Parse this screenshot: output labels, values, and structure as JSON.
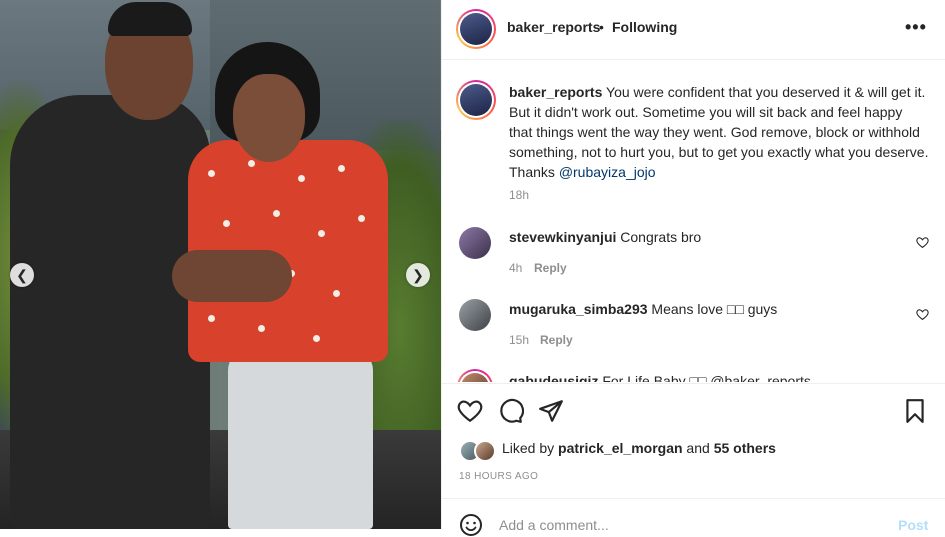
{
  "header": {
    "username": "baker_reports",
    "separator": "•",
    "follow_state": "Following",
    "more_label": "•••"
  },
  "caption": {
    "username": "baker_reports",
    "text": "You were confident that you deserved it & will get it. But it didn't work out. Sometime you will sit back and feel happy that things went the way they went. God remove, block or withhold something, not to hurt you, but to get you exactly what you deserve. Thanks ",
    "mention": "@rubayiza_jojo",
    "time": "18h"
  },
  "comments": [
    {
      "username": "stevewkinyanjui",
      "text": "Congrats bro",
      "time": "4h",
      "reply": "Reply"
    },
    {
      "username": "mugaruka_simba293",
      "text": "Means love □□ guys",
      "time": "15h",
      "reply": "Reply"
    },
    {
      "username": "gabudeusigiz",
      "text": "For Life Baby □□ @baker_reports"
    }
  ],
  "likes": {
    "prefix": "Liked by ",
    "user": "patrick_el_morgan",
    "middle": " and ",
    "others": "55 others"
  },
  "posted_ago": "18 HOURS AGO",
  "add_comment": {
    "placeholder": "Add a comment...",
    "post_label": "Post"
  },
  "colors": {
    "mention": "#00376b",
    "muted": "#8e8e8e",
    "post_disabled": "#b2dffc",
    "story_ring": "#d6249f"
  },
  "icons": {
    "prev": "chevron-left-icon",
    "next": "chevron-right-icon",
    "like": "heart-icon",
    "comment": "comment-icon",
    "share": "paper-plane-icon",
    "save": "bookmark-icon",
    "emoji": "smiley-icon"
  }
}
